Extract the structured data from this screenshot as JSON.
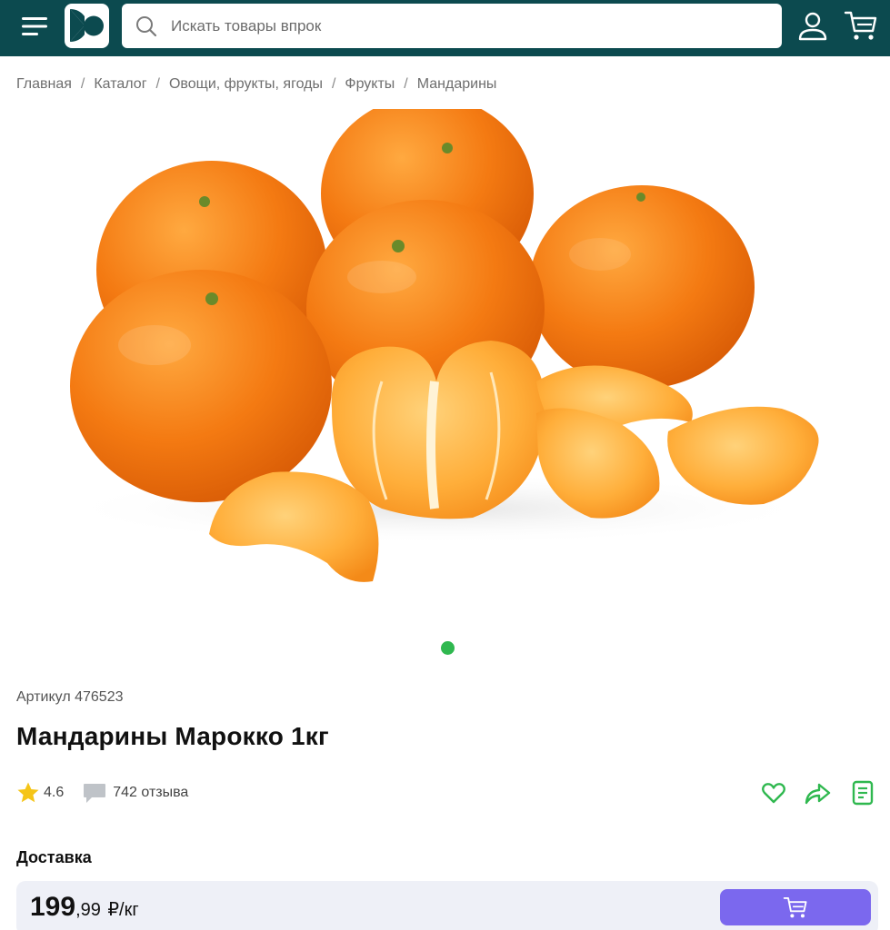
{
  "header": {
    "search_placeholder": "Искать товары впрок",
    "brand_color": "#0c4a4f",
    "icons": [
      "menu-icon",
      "logo",
      "search-icon",
      "user-icon",
      "cart-icon"
    ]
  },
  "breadcrumb": [
    "Главная",
    "Каталог",
    "Овощи, фрукты, ягоды",
    "Фрукты",
    "Мандарины"
  ],
  "breadcrumb_separator": "/",
  "gallery": {
    "image_subject": "mandarins",
    "active_slide": 1,
    "slide_count": 1,
    "indicator_color": "#2fb84f"
  },
  "product": {
    "sku": "Артикул 476523",
    "title": "Мандарины Марокко 1кг",
    "rating": "4.6",
    "reviews": "742 отзыва",
    "delivery_label": "Доставка",
    "price_int": "199",
    "price_frac": ",99",
    "price_unit": "₽/кг"
  },
  "actions": [
    "heart-icon",
    "share-icon",
    "list-icon"
  ],
  "accent_colors": {
    "action_icons": "#2fb84f",
    "buy_button": "#7b68ee",
    "star": "#f5c518"
  }
}
